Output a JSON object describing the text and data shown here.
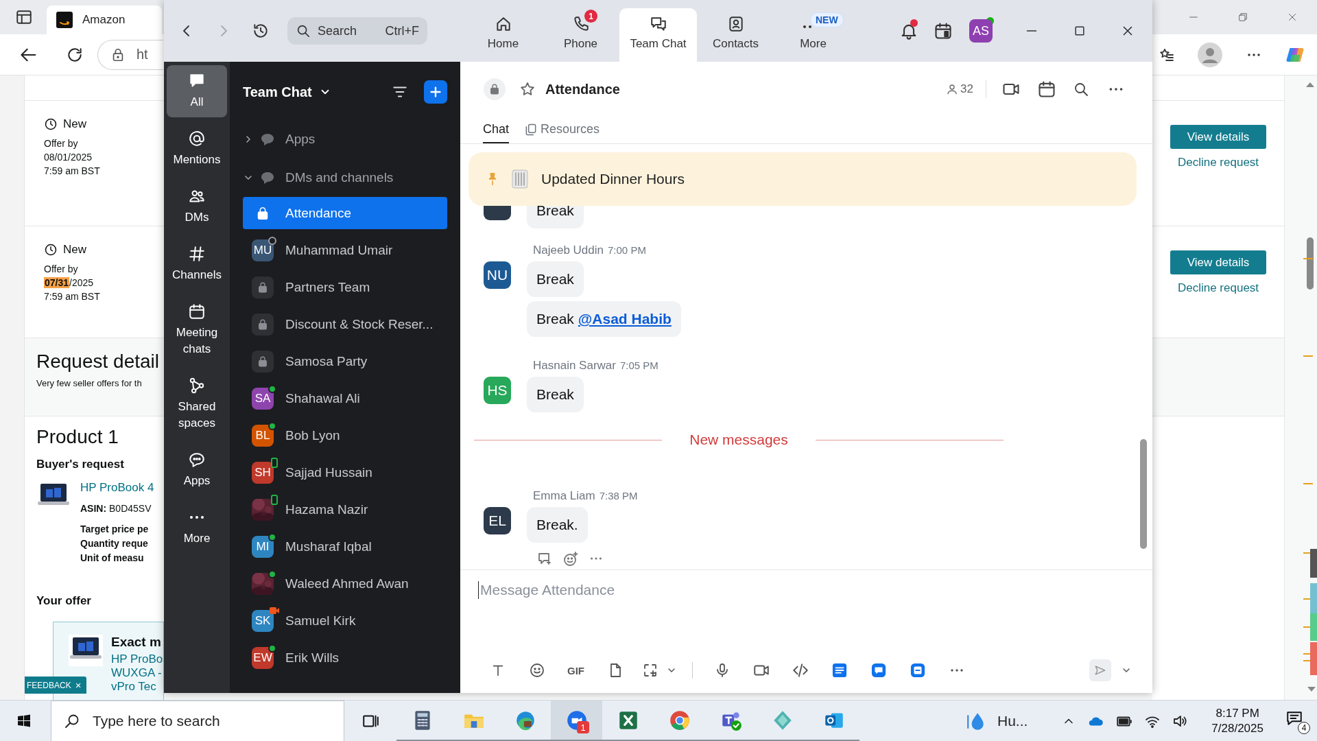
{
  "browser": {
    "tab_title": "Amazon",
    "address": "ht",
    "page": {
      "offers": [
        {
          "status": "New",
          "offer_label": "Offer by",
          "date": [
            {
              "text": "08/01/2025",
              "highlighted": false
            }
          ],
          "time": "7:59 am BST",
          "view_button": "View details",
          "decline_link": "Decline request"
        },
        {
          "status": "New",
          "offer_label": "Offer by",
          "date": [
            {
              "text": "07/31",
              "highlighted": true
            },
            {
              "text": "/2025",
              "highlighted": false
            }
          ],
          "time": "7:59 am BST",
          "view_button": "View details",
          "decline_link": "Decline request"
        }
      ],
      "request_title": "Request detail",
      "request_note": "Very few seller offers for th",
      "product_title": "Product 1",
      "buyers_request": "Buyer's request",
      "product_link": "HP ProBook 4",
      "asin": "**ASIN:** B0D45SV",
      "details": [
        "Target price pe",
        "Quantity reque",
        "Unit of measu"
      ],
      "your_offer": "Your offer",
      "offer_card": {
        "title": "Exact m",
        "lines": [
          "HP ProBo",
          "WUXGA -",
          "vPro Tec"
        ]
      },
      "feedback": {
        "label": "FEEDBACK",
        "close": "×"
      }
    }
  },
  "zoom": {
    "search": {
      "placeholder": "Search",
      "shortcut": "Ctrl+F"
    },
    "tabs": [
      {
        "label": "Home",
        "selected": false
      },
      {
        "label": "Phone",
        "selected": false,
        "badge": "1"
      },
      {
        "label": "Team Chat",
        "selected": true
      },
      {
        "label": "Contacts",
        "selected": false
      },
      {
        "label": "More",
        "selected": false,
        "tag": "NEW"
      }
    ],
    "notifications_unread": true,
    "user": {
      "initials": "AS",
      "color": "#8e3fb0",
      "online": true
    },
    "rail": [
      {
        "label": "All",
        "selected": true
      },
      {
        "label": "Mentions",
        "selected": false
      },
      {
        "label": "DMs",
        "selected": false
      },
      {
        "label": "Channels",
        "selected": false
      },
      {
        "label": "Meeting chats",
        "selected": false
      },
      {
        "label": "Shared spaces",
        "selected": false
      },
      {
        "label": "Apps",
        "selected": false
      },
      {
        "label": "More",
        "selected": false
      }
    ],
    "sidebar": {
      "title": "Team Chat",
      "sections": [
        {
          "label": "Apps",
          "expanded": false
        },
        {
          "label": "DMs and channels",
          "expanded": true
        }
      ],
      "items": [
        {
          "name": "Attendance",
          "kind": "channel",
          "selected": true
        },
        {
          "name": "Muhammad Umair",
          "kind": "person",
          "initials": "MU",
          "color": "#3a5675",
          "online": false,
          "on_mobile": false,
          "in_meeting": false,
          "selected": false
        },
        {
          "name": "Partners Team",
          "kind": "channel",
          "selected": false
        },
        {
          "name": "Discount & Stock Reser...",
          "kind": "channel",
          "selected": false
        },
        {
          "name": "Samosa Party",
          "kind": "channel",
          "selected": false
        },
        {
          "name": "Shahawal Ali",
          "kind": "person",
          "initials": "SA",
          "color": "#8e44ad",
          "online": true,
          "on_mobile": false,
          "in_meeting": false,
          "selected": false
        },
        {
          "name": "Bob Lyon",
          "kind": "person",
          "initials": "BL",
          "color": "#d35400",
          "online": true,
          "on_mobile": false,
          "in_meeting": false,
          "selected": false
        },
        {
          "name": "Sajjad Hussain",
          "kind": "person",
          "initials": "SH",
          "color": "#c0392b",
          "online": true,
          "on_mobile": true,
          "in_meeting": false,
          "selected": false
        },
        {
          "name": "Hazama Nazir",
          "online": true,
          "on_mobile": true,
          "in_meeting": false,
          "selected": false
        },
        {
          "name": "Musharaf Iqbal",
          "kind": "person",
          "initials": "MI",
          "color": "#2e86c1",
          "online": true,
          "on_mobile": false,
          "in_meeting": false,
          "selected": false
        },
        {
          "name": "Waleed Ahmed Awan",
          "online": true,
          "on_mobile": false,
          "in_meeting": false,
          "selected": false
        },
        {
          "name": "Samuel Kirk",
          "kind": "person",
          "initials": "SK",
          "color": "#2e86c1",
          "online": true,
          "on_mobile": false,
          "in_meeting": true,
          "selected": false
        },
        {
          "name": "Erik Wills",
          "kind": "person",
          "initials": "EW",
          "color": "#c0392b",
          "online": true,
          "on_mobile": false,
          "in_meeting": false,
          "selected": false
        }
      ]
    },
    "channel": {
      "title": "Attendance",
      "members": "32",
      "starred": false,
      "tabs": [
        {
          "label": "Chat",
          "selected": true
        },
        {
          "label": "Resources",
          "selected": false
        }
      ],
      "pinned": "Updated Dinner Hours",
      "messages": [
        {
          "kind": "continuation",
          "color": "#2d3a4a",
          "bubbles": [
            {
              "text": "Break"
            }
          ]
        },
        {
          "kind": "message",
          "author": "Najeeb Uddin",
          "time": "7:00 PM",
          "initials": "NU",
          "color": "#1d5a94",
          "bubbles": [
            {
              "text": "Break"
            },
            {
              "text": "Break",
              "mention": "@Asad Habib"
            }
          ]
        },
        {
          "kind": "message",
          "author": "Hasnain Sarwar",
          "time": "7:05 PM",
          "initials": "HS",
          "color": "#27a85a",
          "bubbles": [
            {
              "text": "Break"
            }
          ]
        },
        {
          "kind": "divider",
          "text": "New messages"
        },
        {
          "kind": "message",
          "author": "Emma Liam",
          "time": "7:38 PM",
          "initials": "EL",
          "color": "#2c3a4b",
          "bubbles": [
            {
              "text": "Break."
            }
          ],
          "actions": true
        }
      ],
      "composer": {
        "placeholder": "Message Attendance",
        "gif": "GIF"
      }
    }
  },
  "taskbar": {
    "search_placeholder": "Type here to search",
    "apps": [
      {
        "selected": false
      },
      {
        "selected": false
      },
      {
        "selected": false
      },
      {
        "selected": true,
        "badge": "1"
      },
      {
        "selected": false
      },
      {
        "selected": false
      },
      {
        "selected": false
      },
      {
        "selected": false
      },
      {
        "selected": false
      }
    ],
    "weather": "Hu...",
    "time": "8:17 PM",
    "date": "7/28/2025",
    "notifications": "4"
  }
}
